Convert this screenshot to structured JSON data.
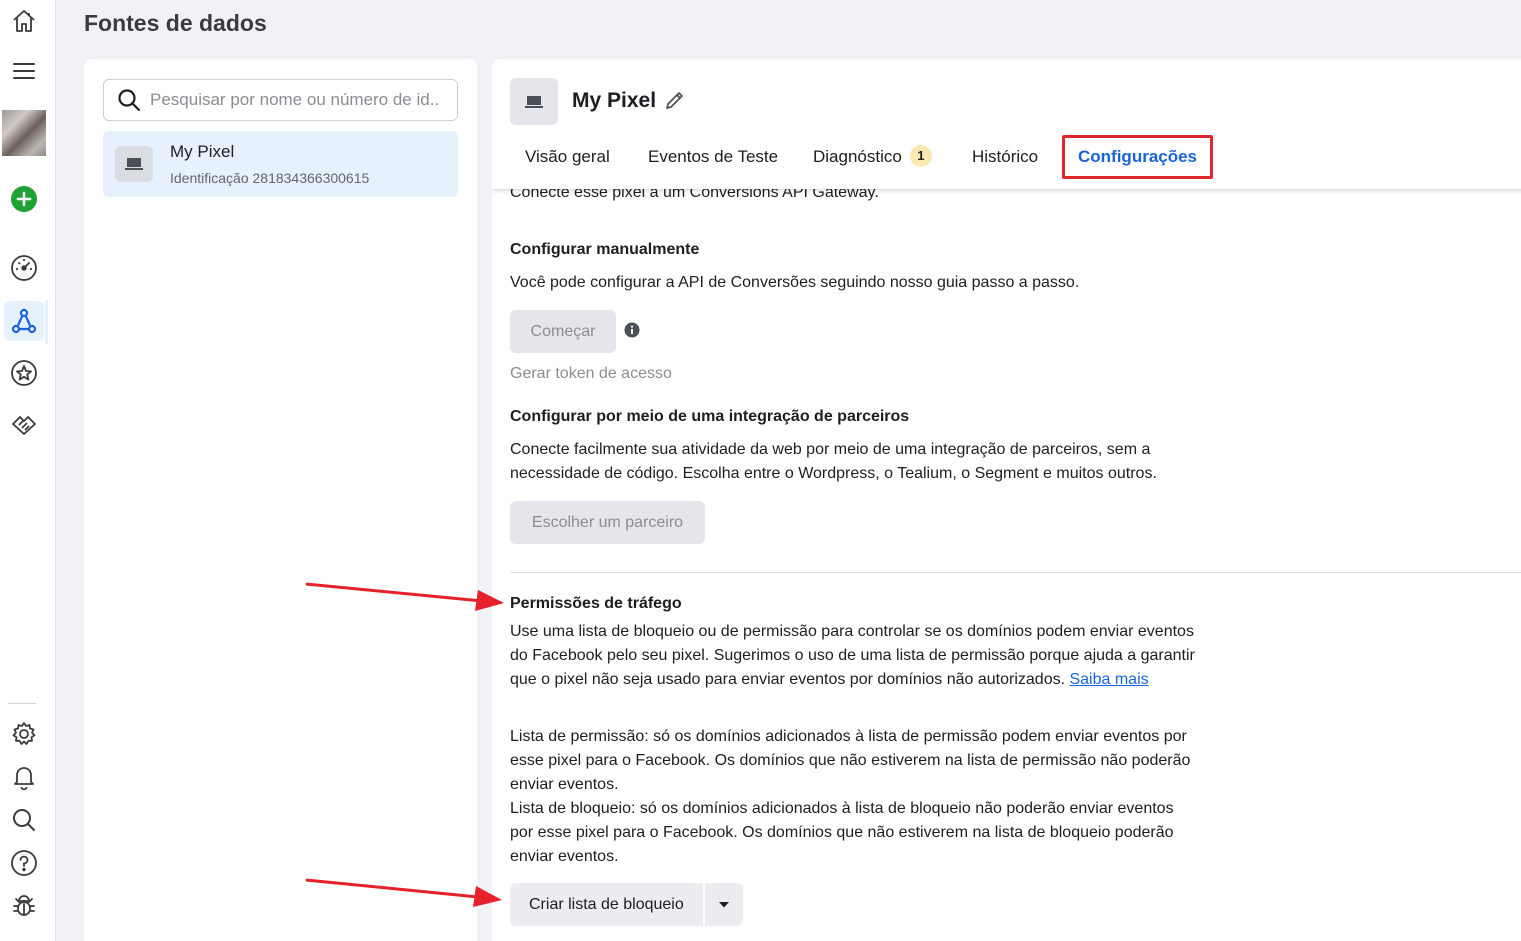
{
  "page": {
    "title": "Fontes de dados"
  },
  "rail": {
    "items": [
      {
        "name": "home-icon"
      },
      {
        "name": "menu-icon"
      },
      {
        "name": "avatar"
      },
      {
        "name": "add-icon",
        "color": "#1fa133"
      },
      {
        "name": "dashboard-icon"
      },
      {
        "name": "data-sources-icon",
        "active": true,
        "color": "#1a63d8"
      },
      {
        "name": "star-icon"
      },
      {
        "name": "handshake-icon"
      },
      {
        "name": "gear-icon"
      },
      {
        "name": "bell-icon"
      },
      {
        "name": "search-icon"
      },
      {
        "name": "help-icon"
      },
      {
        "name": "bug-icon"
      }
    ]
  },
  "left_panel": {
    "search": {
      "placeholder": "Pesquisar por nome ou número de id..."
    },
    "selected_pixel": {
      "name": "My Pixel",
      "id_line": "Identificação 281834366300615"
    }
  },
  "pixel": {
    "name": "My Pixel",
    "tabs": [
      {
        "label": "Visão geral"
      },
      {
        "label": "Eventos de Teste"
      },
      {
        "label": "Diagnóstico",
        "badge": "1"
      },
      {
        "label": "Histórico"
      },
      {
        "label": "Configurações",
        "active": true
      }
    ]
  },
  "content": {
    "gateway_text": "Conecte esse pixel a um Conversions API Gateway.",
    "manual": {
      "heading": "Configurar manualmente",
      "desc": "Você pode configurar a API de Conversões seguindo nosso guia passo a passo.",
      "button": "Começar",
      "token_link": "Gerar token de acesso"
    },
    "partner": {
      "heading": "Configurar por meio de uma integração de parceiros",
      "desc_line1": "Conecte facilmente sua atividade da web por meio de uma integração de parceiros, sem a",
      "desc_line2": "necessidade de código. Escolha entre o Wordpress, o Tealium, o Segment e muitos outros.",
      "button": "Escolher um parceiro"
    },
    "traffic": {
      "heading": "Permissões de tráfego",
      "desc_line1": "Use uma lista de bloqueio ou de permissão para controlar se os domínios podem enviar eventos",
      "desc_line2": "do Facebook pelo seu pixel. Sugerimos o uso de uma lista de permissão porque ajuda a garantir",
      "desc_line3": "que o pixel não seja usado para enviar eventos por domínios não autorizados.",
      "learn_more": "Saiba mais",
      "allow_line1": "Lista de permissão: só os domínios adicionados à lista de permissão podem enviar eventos por",
      "allow_line2": "esse pixel para o Facebook. Os domínios que não estiverem na lista de permissão não poderão",
      "allow_line3": "enviar eventos.",
      "block_line1": "Lista de bloqueio: só os domínios adicionados à lista de bloqueio não poderão enviar eventos",
      "block_line2": "por esse pixel para o Facebook. Os domínios que não estiverem na lista de bloqueio poderão",
      "block_line3": "enviar eventos.",
      "button": "Criar lista de bloqueio"
    }
  },
  "colors": {
    "accent": "#1a63d8",
    "highlight_border": "#e0272c",
    "annotation_arrow": "#e62129",
    "badge_bg": "#fbe9b2"
  }
}
